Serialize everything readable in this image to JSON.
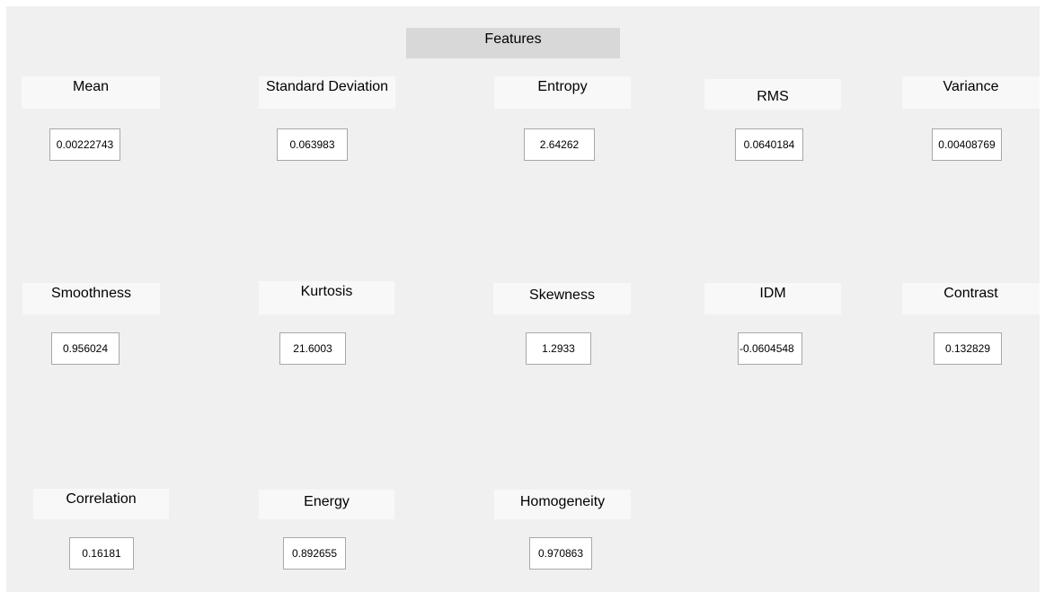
{
  "title": "Features",
  "features": [
    {
      "label": "Mean",
      "value": "0.00222743"
    },
    {
      "label": "Standard Deviation",
      "value": "0.063983"
    },
    {
      "label": "Entropy",
      "value": "2.64262"
    },
    {
      "label": "RMS",
      "value": "0.0640184"
    },
    {
      "label": "Variance",
      "value": "0.00408769"
    },
    {
      "label": "Smoothness",
      "value": "0.956024"
    },
    {
      "label": "Kurtosis",
      "value": "21.6003"
    },
    {
      "label": "Skewness",
      "value": "1.2933"
    },
    {
      "label": "IDM",
      "value": "-0.0604548"
    },
    {
      "label": "Contrast",
      "value": "0.132829"
    },
    {
      "label": "Correlation",
      "value": "0.16181"
    },
    {
      "label": "Energy",
      "value": "0.892655"
    },
    {
      "label": "Homogeneity",
      "value": "0.970863"
    }
  ]
}
